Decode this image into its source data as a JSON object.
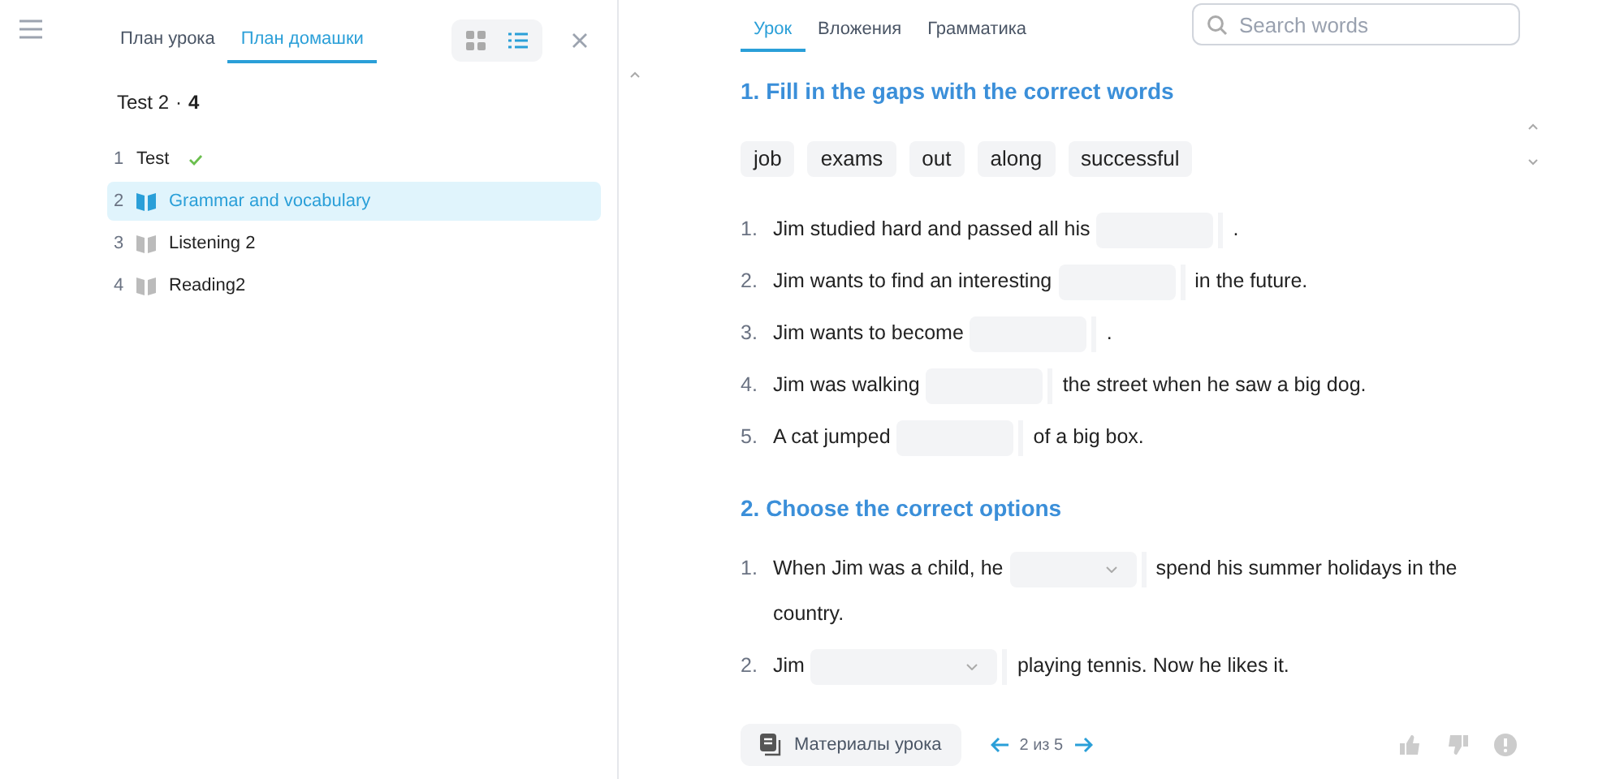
{
  "sidebar": {
    "tabs": [
      {
        "label": "План урока",
        "selected": false
      },
      {
        "label": "План домашки",
        "selected": true
      }
    ],
    "view_modes": [
      {
        "kind": "grid",
        "selected": false
      },
      {
        "kind": "list",
        "selected": true
      }
    ],
    "lesson": {
      "title": "Test 2",
      "separator": "·",
      "count": "4"
    },
    "items": [
      {
        "number": "1",
        "title": "Test",
        "kind": "test",
        "done": true,
        "selected": false
      },
      {
        "number": "2",
        "title": "Grammar and vocabulary",
        "kind": "book",
        "done": false,
        "selected": true
      },
      {
        "number": "3",
        "title": "Listening 2",
        "kind": "book",
        "done": false,
        "selected": false
      },
      {
        "number": "4",
        "title": "Reading2",
        "kind": "book",
        "done": false,
        "selected": false
      }
    ]
  },
  "tabs": [
    {
      "label": "Урок",
      "selected": true
    },
    {
      "label": "Вложения",
      "selected": false
    },
    {
      "label": "Грамматика",
      "selected": false
    }
  ],
  "search": {
    "placeholder": "Search words"
  },
  "exercises": [
    {
      "title": "1. Fill in the gaps with the correct words",
      "kind": "gaps",
      "word_bank": [
        "job",
        "exams",
        "out",
        "along",
        "successful"
      ],
      "items": [
        {
          "number": "1.",
          "before": "Jim studied hard and passed all his",
          "after": "."
        },
        {
          "number": "2.",
          "before": "Jim wants to find an interesting",
          "after": "in the future."
        },
        {
          "number": "3.",
          "before": "Jim wants to become",
          "after": "."
        },
        {
          "number": "4.",
          "before": "Jim was walking",
          "after": "the street when he saw a big dog."
        },
        {
          "number": "5.",
          "before": "A cat jumped",
          "after": "of a big box."
        }
      ]
    },
    {
      "title": "2. Choose the correct options",
      "kind": "options",
      "items": [
        {
          "number": "1.",
          "before": "When Jim was a child, he",
          "after": "spend his summer holidays in the",
          "after_continued": "country."
        },
        {
          "number": "2.",
          "before": "Jim",
          "after": "playing tennis. Now he likes it."
        }
      ]
    }
  ],
  "footer": {
    "materials": "Материалы урока",
    "pager": "2 из 5"
  }
}
